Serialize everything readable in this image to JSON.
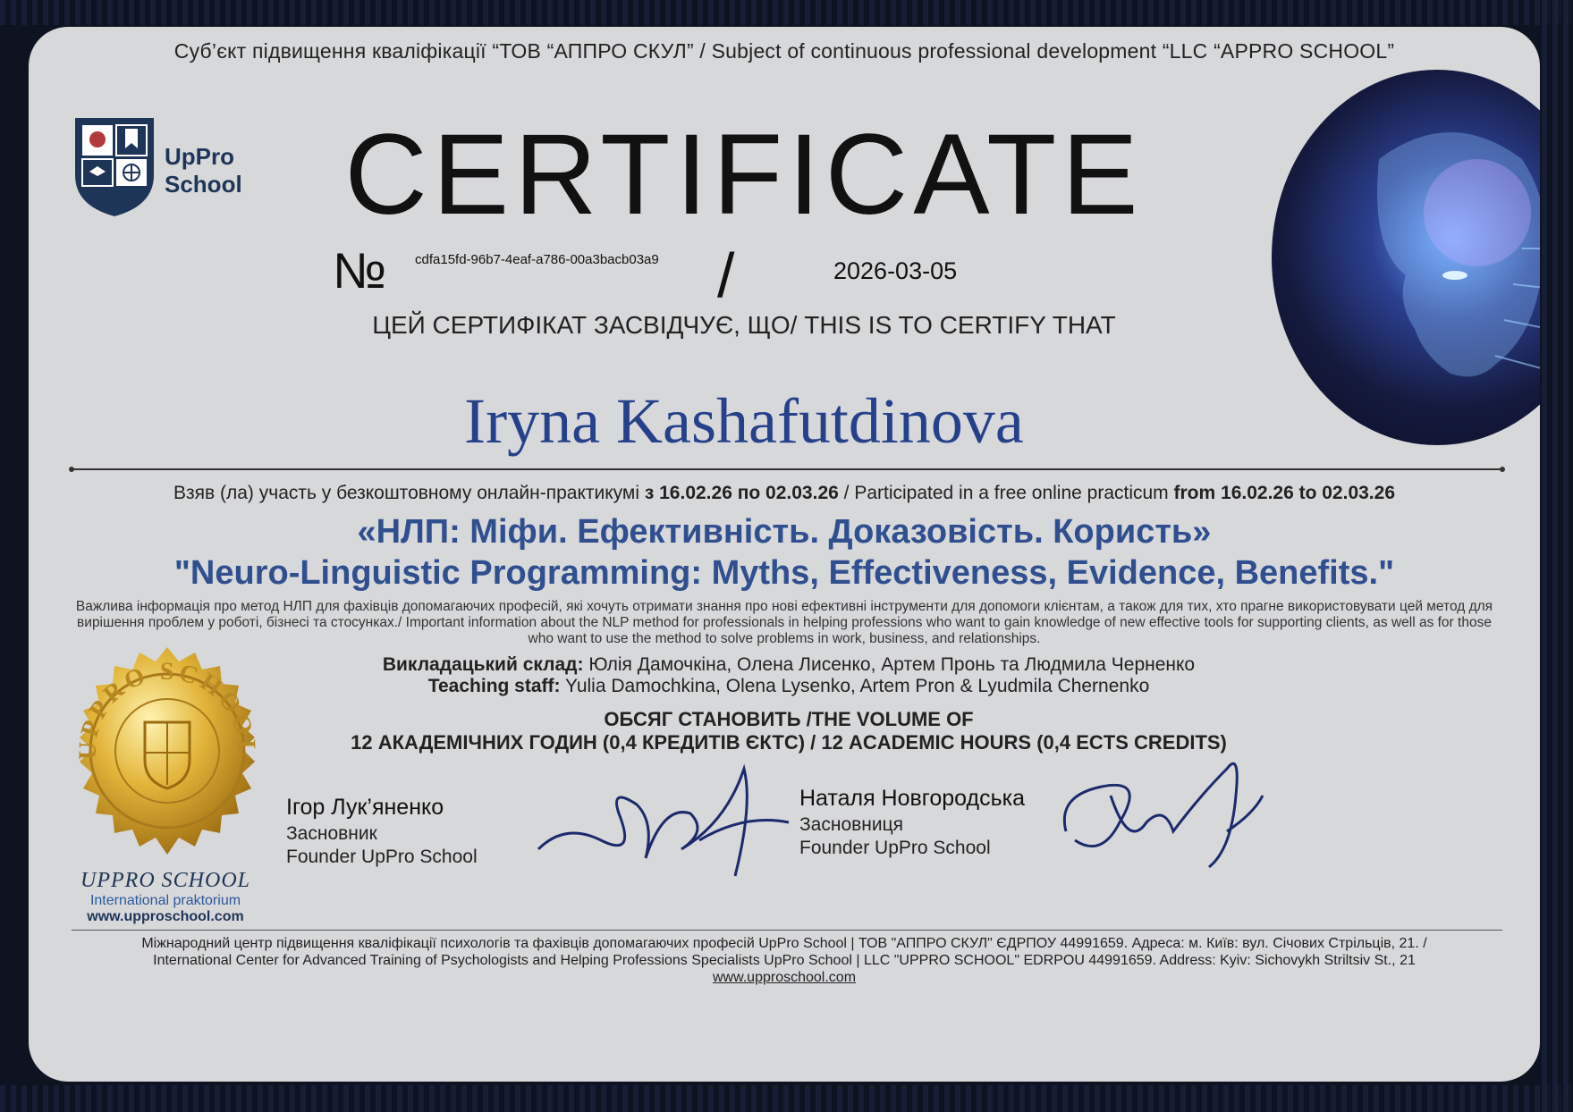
{
  "header": {
    "subject_line": "Суб’єкт підвищення кваліфікації “ТОВ “АППРО СКУЛ” / Subject of continuous professional development  “LLC “APPRO SCHOOL”"
  },
  "logo": {
    "line1": "UpPro",
    "line2": "School"
  },
  "certificate": {
    "title": "CERTIFICATE",
    "number_sign": "№",
    "id": "cdfa15fd-96b7-4eaf-a786-00a3bacb03a9",
    "separator": "/",
    "date": "2026-03-05",
    "certify_line": "ЦЕЙ СЕРТИФІКАТ ЗАСВІДЧУЄ, ЩО/ THIS IS TO CERTIFY THAT",
    "recipient": "Iryna Kashafutdinova"
  },
  "participation": {
    "ua_prefix": "Взяв (ла) участь у безкоштовному онлайн-практикумі ",
    "ua_dates": "з 16.02.26 по 02.03.26",
    "middle": " / Participated in a free online practicum ",
    "en_dates": "from 16.02.26 to 02.03.26"
  },
  "course": {
    "title_ua": "«НЛП: Міфи. Ефективність. Доказовість. Користь»",
    "title_en": "\"Neuro-Linguistic Programming: Myths, Effectiveness, Evidence, Benefits.\"",
    "description": "Важлива інформація про метод НЛП для фахівців допомагаючих професій, які хочуть отримати знання про нові ефективні інструменти для допомоги клієнтам, а також для тих, хто прагне використовувати цей метод для вирішення проблем у роботі, бізнесі та стосунках./ Important information about the NLP method for professionals in helping professions who want to gain knowledge of new effective tools for supporting clients, as well as for those who want to use the method to solve problems in work, business, and relationships."
  },
  "staff": {
    "ua_label": "Викладацький склад:",
    "ua_names": " Юлія Дамочкіна, Олена Лисенко, Артем Пронь та Людмила Черненко",
    "en_label": "Teaching staff:",
    "en_names": " Yulia Damochkina, Olena Lysenko, Artem Pron & Lyudmila Chernenko"
  },
  "volume": {
    "line1": "ОБСЯГ СТАНОВИТЬ /THE VOLUME OF",
    "line2": "12 АКАДЕМІЧНИХ ГОДИН (0,4 КРЕДИТІВ ЄКТС) / 12 ACADEMIC HOURS (0,4 ECTS CREDITS)"
  },
  "seal": {
    "ring_text": "UPPRO SCHOOL",
    "name": "UPPRO SCHOOL",
    "subtitle": "International praktorium",
    "url": "www.upproschool.com"
  },
  "signers": [
    {
      "name": "Ігор Лук’яненко",
      "role_ua": "Засновник",
      "role_en": "Founder UpPro School"
    },
    {
      "name": "Наталя Новгородська",
      "role_ua": "Засновниця",
      "role_en": "Founder UpPro School"
    }
  ],
  "footer": {
    "line1": "Міжнародний центр підвищення кваліфікації психологів та фахівців допомагаючих професій UpPro School | ТОВ \"АППРО СКУЛ\" ЄДРПОУ 44991659. Адреса: м. Київ: вул. Січових Стрільців, 21. /",
    "line2": "International Center for Advanced Training of Psychologists and Helping Professions Specialists UpPro School | LLC \"UPPRO SCHOOL\" EDRPOU 44991659. Address: Kyiv: Sichovykh Striltsiv St., 21",
    "url": "www.upproschool.com"
  },
  "colors": {
    "accent_blue": "#2f4f8f",
    "recipient_blue": "#24418a",
    "navy": "#1d3557",
    "gold": "#d4a017"
  }
}
